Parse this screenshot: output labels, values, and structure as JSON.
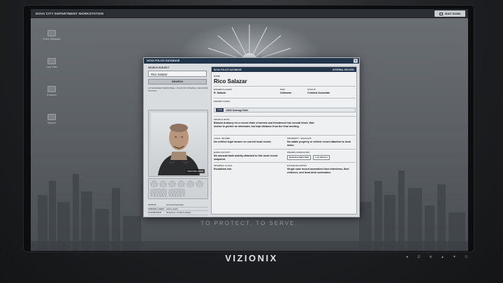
{
  "topbar": {
    "title": "NOVA CITY DEPARTMENT WORKSTATION",
    "shutdown_label": "SHUT DOWN"
  },
  "desktop_icons": [
    {
      "label": "Police Database",
      "icon": "folder-icon"
    },
    {
      "label": "Case Files",
      "icon": "folder-icon"
    },
    {
      "label": "Evidence",
      "icon": "folder-icon"
    },
    {
      "label": "Reports",
      "icon": "folder-icon"
    }
  ],
  "window": {
    "title": "NOVA POLICE DATABASE",
    "close_label": "×",
    "search": {
      "label": "SEARCH SUBJECT",
      "value": "Rico Salazar",
      "button": "SEARCH"
    },
    "auth_text": "AUTHORIZED PERSONNEL / NOVA PD INTERNAL RECORDS STATION",
    "photo_tag": "TERM REC #0000",
    "meta": [
      {
        "k": "STATUS",
        "v": "Criminal Associate"
      },
      {
        "k": "SURVEILLANCE",
        "v": "Active watch"
      },
      {
        "k": "CLEARANCE",
        "v": "Detective / Limited release"
      }
    ],
    "record": {
      "header_left": "NOVA POLICE DATABASE",
      "header_right": "INTERNAL RECORD",
      "name_label": "NAME",
      "name": "Rico Salazar",
      "aliases_label": "KNOWN ALIASES",
      "aliases": "R. Salazar",
      "dob_label": "DOB",
      "dob": "Unknown",
      "status_label": "STATUS",
      "status": "Criminal Associate",
      "known_label": "KNOWN CASES",
      "known_pill": "CASE",
      "known_case": "#3030 Drainage Ditch",
      "profile_label": "PROFILE NOTE",
      "profile": "Blamed Anthony for a recent chain of arrests and threatened him several times. Had motive to punish an informant, but kept distance from the final meeting.",
      "legal_label": "LEGAL INCOME",
      "legal": "No verified legal income on current local record.",
      "property_label": "PROPERTY / VEHICLES",
      "property": "No stable property or vehicle record attached to local index.",
      "bank_label": "BANK ACTIVITY",
      "bank": "No unusual bank activity attached to this local record snapshot.",
      "associates_label": "KNOWN ASSOCIATES",
      "associates": [
        "Detective Mark Ellis",
        "Luis Moreno"
      ],
      "flags_label": "INTERNAL FLAGS",
      "flags": "Escalation risk",
      "notes_label": "DATABASE NOTES",
      "notes": "Single case record assembled from interviews, filed evidence, and local desk summaries."
    }
  },
  "motto": "TO PROTECT. TO SERVE.",
  "brand": "VIZIONIX",
  "controls": [
    "◄",
    "☰",
    "⊕",
    "▲",
    "▼",
    "⏻"
  ]
}
